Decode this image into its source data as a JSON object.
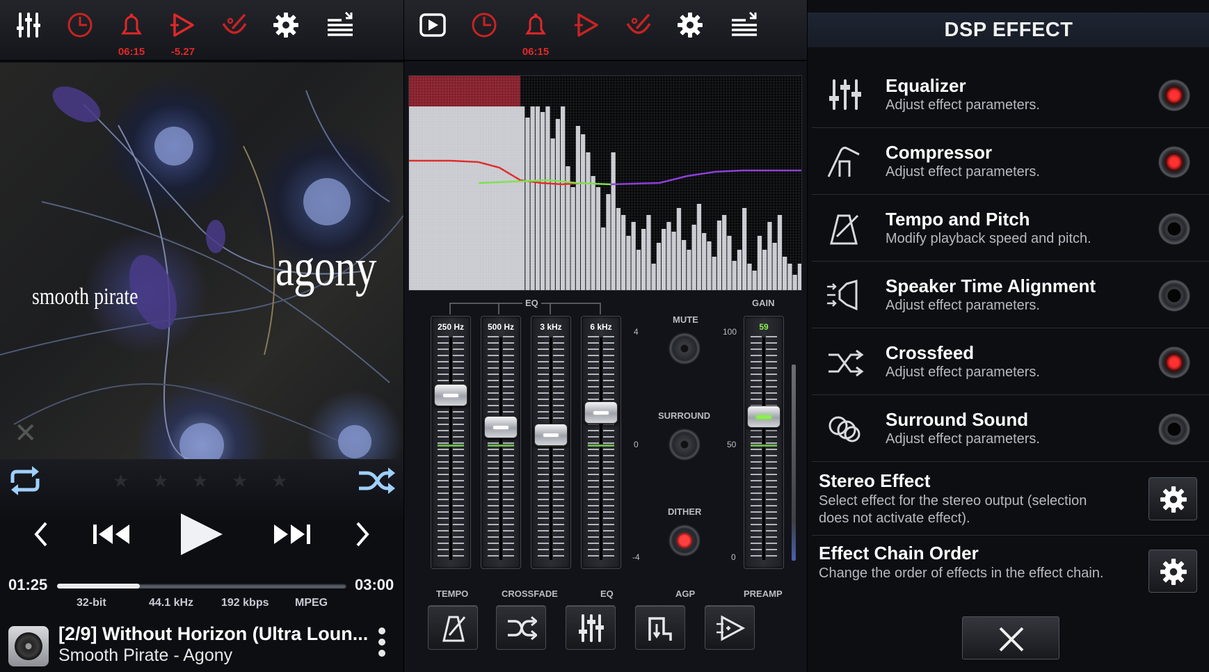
{
  "player": {
    "toolbar": {
      "timer_sub": "06:15",
      "speed_sub": "-5.27"
    },
    "art": {
      "album": "agony",
      "artist": "smooth pirate"
    },
    "rating": {
      "stars": 5,
      "value": 0
    },
    "time_elapsed": "01:25",
    "time_total": "03:00",
    "progress": 0.285,
    "format": {
      "bits": "32-bit",
      "rate": "44.1 kHz",
      "bitrate": "192 kbps",
      "codec": "MPEG"
    },
    "track": {
      "title": "[2/9] Without Horizon (Ultra Loun...",
      "subtitle": "Smooth Pirate - Agony"
    }
  },
  "mixer": {
    "toolbar": {
      "timer_sub": "06:15"
    },
    "eq_group_label": "EQ",
    "gain_label": "GAIN",
    "bands": [
      {
        "label": "250 Hz",
        "value": 1.6
      },
      {
        "label": "500 Hz",
        "value": 0.3
      },
      {
        "label": "3 kHz",
        "value": 0.0
      },
      {
        "label": "6 kHz",
        "value": 0.9
      }
    ],
    "eq_scale": {
      "top": "4",
      "mid": "0",
      "bottom": "-4"
    },
    "gain": {
      "value": "59",
      "scale_top": "100",
      "scale_mid": "50",
      "scale_bottom": "0"
    },
    "knobs": {
      "mute": "MUTE",
      "surround": "SURROUND",
      "dither": "DITHER"
    },
    "buttons": {
      "tempo": "TEMPO",
      "crossfade": "CROSSFADE",
      "eq": "EQ",
      "agp": "AGP",
      "preamp": "PREAMP"
    }
  },
  "dsp": {
    "title": "DSP EFFECT",
    "effects": [
      {
        "name": "Equalizer",
        "desc": "Adjust effect parameters.",
        "on": true
      },
      {
        "name": "Compressor",
        "desc": "Adjust effect parameters.",
        "on": true
      },
      {
        "name": "Tempo and Pitch",
        "desc": "Modify playback speed and pitch.",
        "on": false
      },
      {
        "name": "Speaker Time Alignment",
        "desc": "Adjust effect parameters.",
        "on": false
      },
      {
        "name": "Crossfeed",
        "desc": "Adjust effect parameters.",
        "on": true
      },
      {
        "name": "Surround Sound",
        "desc": "Adjust effect parameters.",
        "on": false
      }
    ],
    "stereo": {
      "name": "Stereo Effect",
      "desc": "Select effect for the stereo output (selection does not activate effect)."
    },
    "chain": {
      "name": "Effect Chain Order",
      "desc": "Change the order of effects in the effect chain."
    }
  },
  "colors": {
    "accent_red": "#e02828",
    "eq_green": "#69b64a",
    "gain_green": "#8bf04c"
  }
}
